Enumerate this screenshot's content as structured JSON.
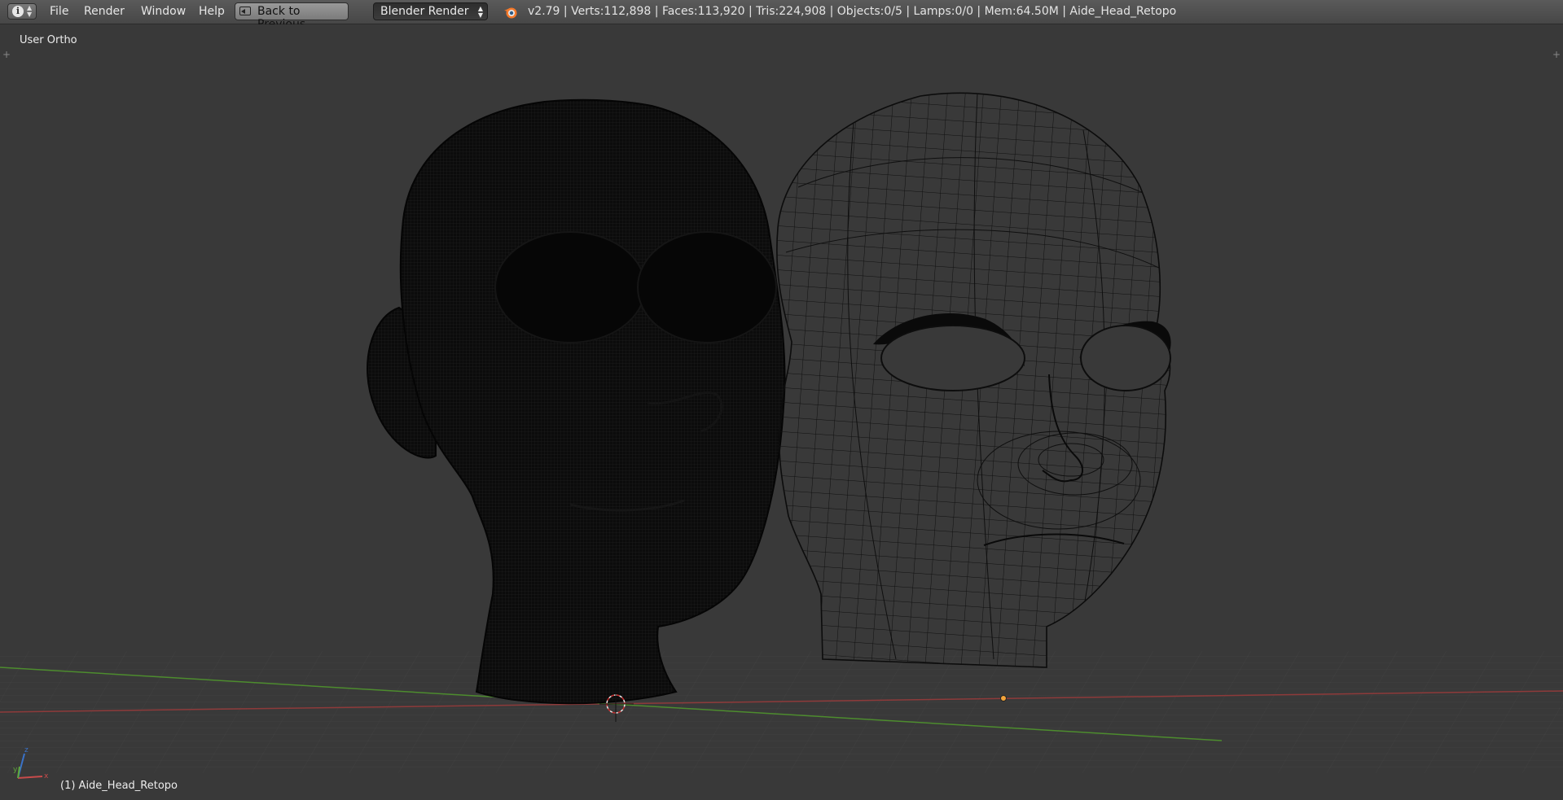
{
  "header": {
    "menus": [
      "File",
      "Render",
      "Window",
      "Help"
    ],
    "back_button": "Back to Previous",
    "render_engine": "Blender Render",
    "stats": "v2.79 | Verts:112,898 | Faces:113,920 | Tris:224,908 | Objects:0/5 | Lamps:0/0 | Mem:64.50M | Aide_Head_Retopo"
  },
  "viewport": {
    "view_name": "User Ortho",
    "active_object": "(1) Aide_Head_Retopo",
    "axes": {
      "x": "x",
      "y": "y",
      "z": "z"
    }
  },
  "colors": {
    "background": "#393939",
    "x_axis": "#8e3a3a",
    "y_axis": "#4d8c2e",
    "wire": "#0d0d0d",
    "origin_dot": "#f2a33a",
    "cursor": "#c83030"
  },
  "icons": [
    "info-icon",
    "back-icon",
    "blender-logo-icon",
    "3d-cursor-icon",
    "axis-gizmo-icon"
  ]
}
